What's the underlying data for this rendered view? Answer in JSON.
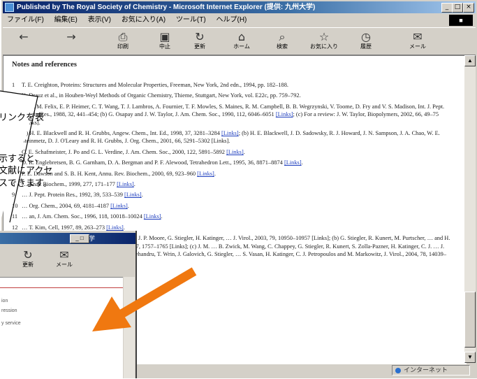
{
  "window": {
    "title": "Published by The Royal Society of Chemistry - Microsoft Internet Explorer (提供: 九州大学)",
    "min": "_",
    "max": "□",
    "close": "×"
  },
  "menu": [
    "ファイル(F)",
    "編集(E)",
    "表示(V)",
    "お気に入り(A)",
    "ツール(T)",
    "ヘルプ(H)"
  ],
  "toolbar": {
    "buttons": [
      {
        "icon": "back-icon",
        "label": ""
      },
      {
        "icon": "forward-icon",
        "label": ""
      },
      {
        "icon": "print-icon",
        "label": "印刷"
      },
      {
        "icon": "stop-icon",
        "label": "中止"
      },
      {
        "icon": "refresh-icon",
        "label": "更新"
      },
      {
        "icon": "home-icon",
        "label": "ホーム"
      },
      {
        "icon": "search-icon",
        "label": "検索"
      },
      {
        "icon": "favorites-icon",
        "label": "お気に入り"
      },
      {
        "icon": "history-icon",
        "label": "履歴"
      },
      {
        "icon": "mail-icon",
        "label": "メール"
      }
    ]
  },
  "content": {
    "heading": "Notes and references",
    "refs": [
      {
        "n": "1",
        "text": "T. E. Creighton, Proteins: Structures and Molecular Properties, Freeman, New York, 2nd edn., 1994, pp. 182–188."
      },
      {
        "n": "2",
        "text": "K. Drauz et al., in Houben-Weyl Methods of Organic Chemistry, Thieme, Stuttgart, New York, vol. E22c, pp. 759–792."
      },
      {
        "n": "3",
        "text": "(a) A. M. Felix, E. P. Heimer, C. T. Wang, T. J. Lambros, A. Fournier, T. F. Mowles, S. Maines, R. M. Campbell, B. B. Wegrzynski, V. Toome, D. Fry and V. S. Madison, Int. J. Pept. Protein Res., 1988, 32, 441–454; (b) G. Osapay and J. W. Taylor, J. Am. Chem. Soc., 1990, 112, 6046–6051 ",
        "link": "[Links]",
        "tail": "; (c) For a review: J. W. Taylor, Biopolymers, 2002, 66, 49–75 [Links]."
      },
      {
        "n": "4",
        "text": "(a) H. E. Blackwell and R. H. Grubbs, Angew. Chem., Int. Ed., 1998, 37, 3281–3284 ",
        "link": "[Links]",
        "tail": "; (b) H. E. Blackwell, J. D. Sadowsky, R. J. Howard, J. N. Sampson, J. A. Chao, W. E. Steinmetz, D. J. O'Leary and R. H. Grubbs, J. Org. Chem., 2001, 66, 5291–5302 [Links]."
      },
      {
        "n": "5",
        "text": "C. E. Schafmeister, J. Po and G. L. Verdine, J. Am. Chem. Soc., 2000, 122, 5891–5892 ",
        "link": "[Links]",
        "tail": "."
      },
      {
        "n": "6",
        "text": "D. R. Englebretsen, B. G. Garnham, D. A. Bergman and P. F. Alewood, Tetrahedron Lett., 1995, 36, 8871–8874 ",
        "link": "[Links]",
        "tail": "."
      },
      {
        "n": "7",
        "text": "P. E. Dawson and S. B. H. Kent, Annu. Rev. Biochem., 2000, 69, 923–960 ",
        "link": "[Links]",
        "tail": "."
      },
      {
        "n": "8",
        "text": "… Anal. Biochem., 1999, 277, 171–177 ",
        "link": "[Links]",
        "tail": "."
      },
      {
        "n": "9",
        "text": "… J. Pept. Protein Res., 1992, 39, 533–539 ",
        "link": "[Links]",
        "tail": "."
      },
      {
        "n": "10",
        "text": "… Org. Chem., 2004, 69, 4181–4187 ",
        "link": "[Links]",
        "tail": "."
      },
      {
        "n": "11",
        "text": "… an, J. Am. Chem. Soc., 1996, 118, 10018–10024 ",
        "link": "[Links]",
        "tail": "."
      },
      {
        "n": "12",
        "text": "… T. Kim, Cell, 1997, 89, 263–273 ",
        "link": "[Links]",
        "tail": "."
      },
      {
        "n": "13",
        "text": "… Wang, C. Speicher, E. O. Saphire, J. M. Ruby, J. P. Moore, G. Stiegler, H. Katinger, … J. Virol., 2003, 79, 10950–10957 [Links]; (b) G. Stiegler, R. Kunert, M. Purtscher, … and H. Katinger, AIDS Res. Hum. Retroviruses, 2001, 17, 1757–1765 [Links]; (c) J. M. … B. Zwick, M. Wang, C. Chappey, G. Stiegler, R. Kunert, S. Zolla-Pazner, H. Katinger, C. J. … J. Virol., 2005, 79, 13232–13252 [Links]; (d) E. Mehandru, T. Wrin, J. Galovich, G. Stiegler, … S. Vasan, H. Katinger, C. J. Petropoulos and M. Markowitz, J. Virol., 2004, 78, 14039–"
      }
    ]
  },
  "status": {
    "zone": "インターネット"
  },
  "popup": {
    "title": "九州大学",
    "min": "_ □",
    "toolbar": [
      {
        "icon": "refresh-icon",
        "label": "更新"
      },
      {
        "icon": "mail-icon",
        "label": "メール"
      }
    ],
    "lines": [
      "ion",
      "ression",
      "y service"
    ]
  },
  "callout": {
    "lines": [
      "リンクを表",
      "示すると、",
      "文献にアクセ",
      "スできます。"
    ]
  },
  "colors": {
    "accent_arrow": "#f07810",
    "link": "#1f3fbf",
    "titlebar": "#0a246a"
  }
}
